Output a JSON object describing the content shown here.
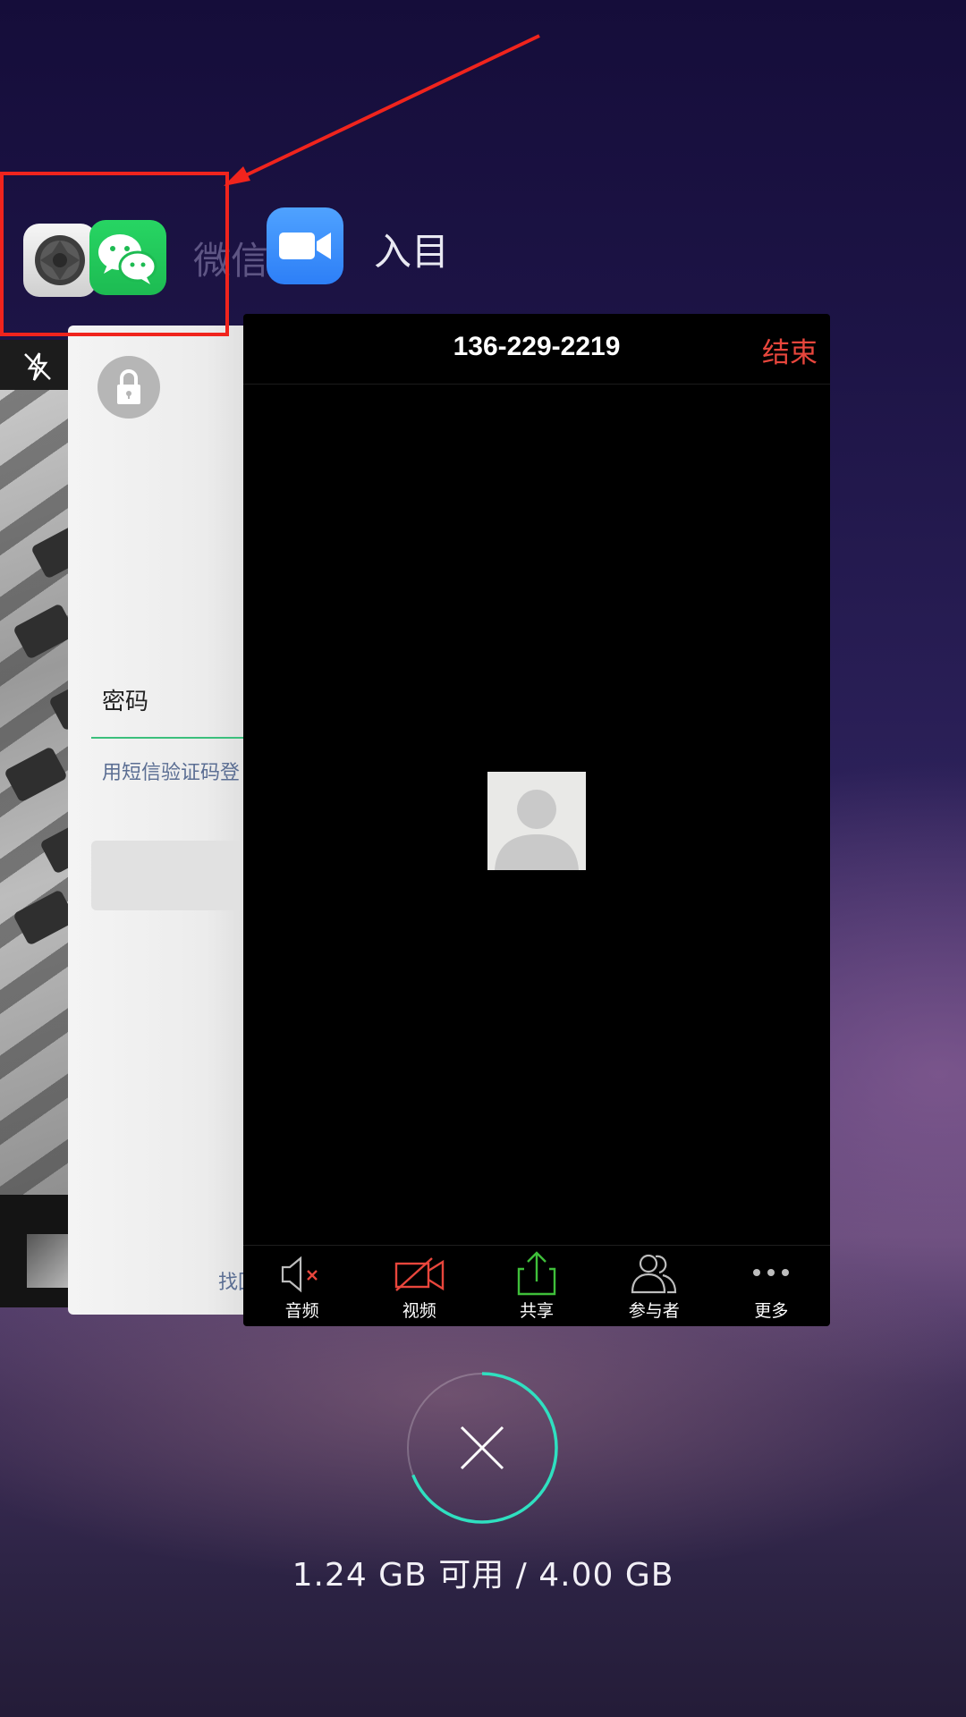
{
  "recents": {
    "wechat": {
      "app_name": "微信",
      "password_label": "密码",
      "sms_login_link": "用短信验证码登",
      "find_link": "找回"
    },
    "zoom": {
      "app_name": "入目",
      "meeting_id": "136-229-2219",
      "end_label": "结束",
      "toolbar": [
        {
          "label": "音频",
          "icon": "audio-muted-icon"
        },
        {
          "label": "视频",
          "icon": "video-off-icon"
        },
        {
          "label": "共享",
          "icon": "share-icon"
        },
        {
          "label": "参与者",
          "icon": "participants-icon"
        },
        {
          "label": "更多",
          "icon": "more-icon"
        }
      ]
    },
    "camera": {
      "icon": "camera-icon"
    }
  },
  "memory": {
    "text": "1.24 GB 可用 / 4.00 GB",
    "used_fraction": 0.69
  },
  "colors": {
    "annotation": "#f0241d",
    "zoom_end": "#e8463c",
    "clear_ring": "#2fe0c0"
  }
}
